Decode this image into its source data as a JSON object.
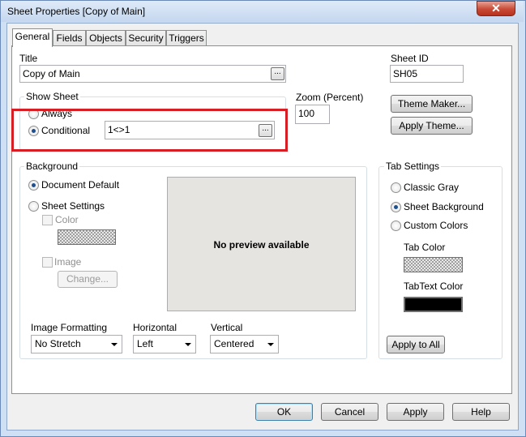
{
  "window": {
    "title": "Sheet Properties [Copy of Main]",
    "close_glyph": "✕"
  },
  "tabs": [
    {
      "label": "General",
      "active": true
    },
    {
      "label": "Fields"
    },
    {
      "label": "Objects"
    },
    {
      "label": "Security"
    },
    {
      "label": "Triggers"
    }
  ],
  "general": {
    "title_label": "Title",
    "title_value": "Copy of Main",
    "ellipsis": "...",
    "sheet_id_label": "Sheet ID",
    "sheet_id_value": "SH05",
    "show_sheet": {
      "label": "Show Sheet",
      "always": "Always",
      "conditional": "Conditional",
      "selected": "Conditional",
      "condition_value": "1<>1"
    },
    "zoom": {
      "label": "Zoom (Percent)",
      "value": "100"
    },
    "theme_maker_button": "Theme Maker...",
    "apply_theme_button": "Apply Theme...",
    "background": {
      "label": "Background",
      "document_default": "Document Default",
      "sheet_settings": "Sheet Settings",
      "selected": "Document Default",
      "color": "Color",
      "image": "Image",
      "change_button": "Change...",
      "preview_text": "No preview available",
      "image_formatting_label": "Image Formatting",
      "image_formatting_value": "No Stretch",
      "horizontal_label": "Horizontal",
      "horizontal_value": "Left",
      "vertical_label": "Vertical",
      "vertical_value": "Centered"
    },
    "tab_settings": {
      "label": "Tab Settings",
      "classic_gray": "Classic Gray",
      "sheet_background": "Sheet Background",
      "custom_colors": "Custom Colors",
      "selected": "Sheet Background",
      "tab_color_label": "Tab Color",
      "tab_text_color_label": "TabText Color",
      "tab_text_color": "#000000",
      "apply_to_all": "Apply to All"
    }
  },
  "footer": {
    "ok": "OK",
    "cancel": "Cancel",
    "apply": "Apply",
    "help": "Help"
  },
  "colors": {
    "highlight_box": "#d81e25",
    "window_frame": "#cfe0f4"
  }
}
